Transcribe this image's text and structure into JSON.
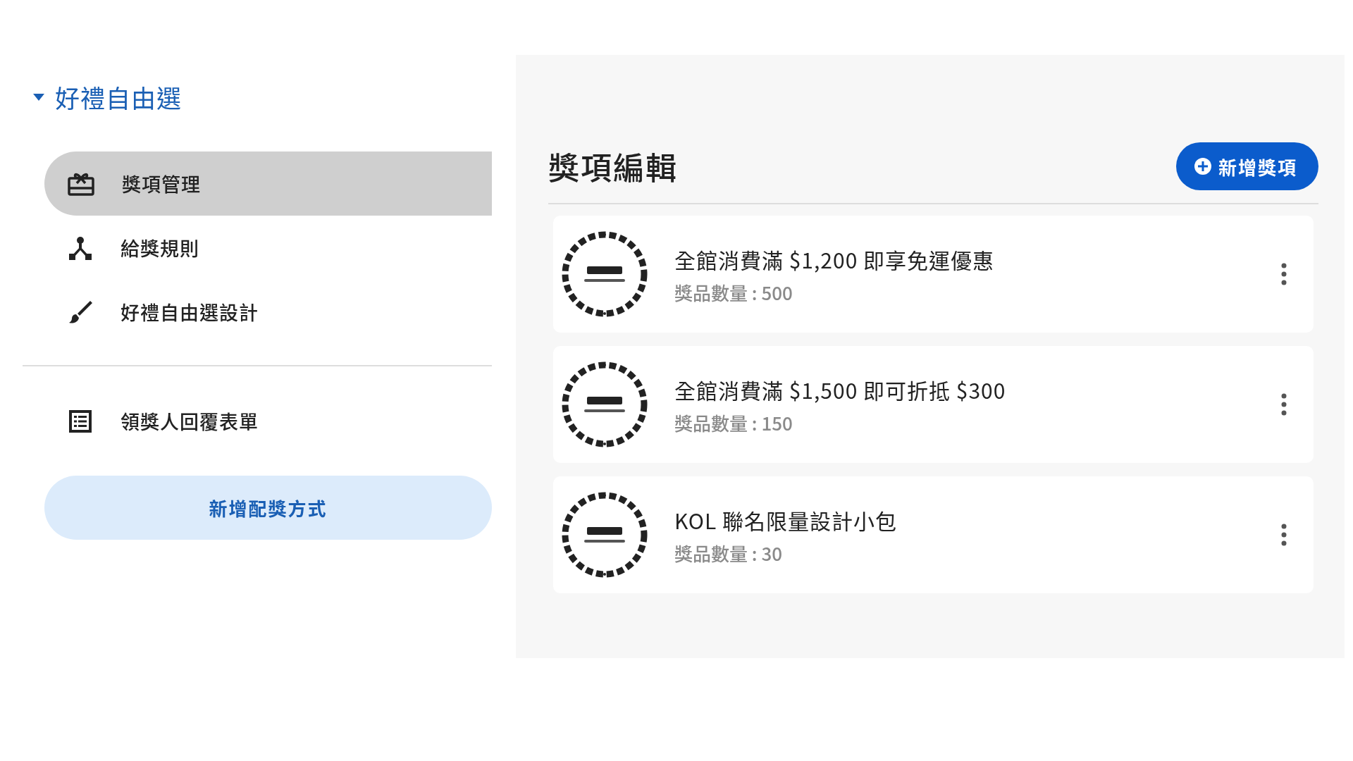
{
  "sidebar": {
    "group": {
      "title": "好禮自由選",
      "expanded": true
    },
    "items": [
      {
        "label": "獎項管理",
        "kind": "gift",
        "selected": true
      },
      {
        "label": "給獎規則",
        "kind": "branch",
        "selected": false
      },
      {
        "label": "好禮自由選設計",
        "kind": "brush",
        "selected": false
      }
    ],
    "secondary_items": [
      {
        "label": "領獎人回覆表單",
        "kind": "list",
        "selected": false
      }
    ],
    "add_button": "新增配獎方式"
  },
  "main": {
    "title": "獎項編輯",
    "add_button": "新增獎項",
    "prizes": [
      {
        "name": "全館消費滿 $1,200 即享免運優惠",
        "count": "獎品數量 : 500"
      },
      {
        "name": "全館消費滿 $1,500 即可折抵 $300",
        "count": "獎品數量 : 150"
      },
      {
        "name": "KOL 聯名限量設計小包",
        "count": "獎品數量 : 30"
      }
    ]
  }
}
